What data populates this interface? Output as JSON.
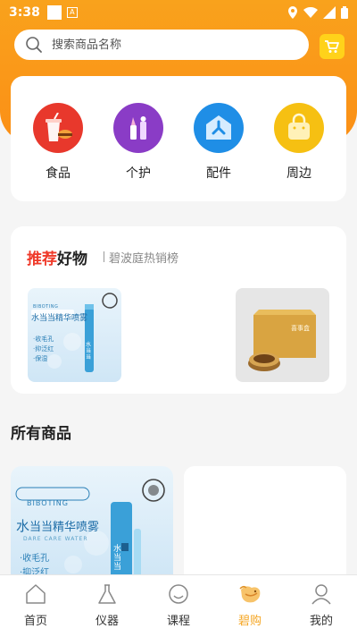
{
  "status_bar": {
    "time": "3:38",
    "right_icons": [
      "location-icon",
      "wifi-icon",
      "signal-icon",
      "battery-icon"
    ]
  },
  "search": {
    "placeholder": "搜索商品名称"
  },
  "categories": [
    {
      "label": "食品",
      "icon": "food-icon",
      "color": "#e8382c"
    },
    {
      "label": "个护",
      "icon": "cosmetics-icon",
      "color": "#8a3cc6"
    },
    {
      "label": "配件",
      "icon": "accessory-icon",
      "color": "#1f8ee6"
    },
    {
      "label": "周边",
      "icon": "bag-icon",
      "color": "#f6c012"
    }
  ],
  "recommend": {
    "title_red": "推荐",
    "title_rest": "好物",
    "subtitle": "碧波庭热销榜",
    "products": [
      {
        "icon": "spray-product-image",
        "brand": "BIBOTING",
        "name": "水当当精华喷雾",
        "tag": "水当当",
        "features": [
          "·收毛孔",
          "·抑泛红",
          "·保湿"
        ]
      },
      {
        "icon": "gift-box-product-image",
        "box_label": "喜事盒"
      }
    ]
  },
  "all_products": {
    "title": "所有商品",
    "items": [
      {
        "icon": "spray-product-image",
        "brand": "BIBOTING",
        "name": "当当精华喷雾",
        "name_prefix": "水",
        "tagline": "DARE CARE WATER",
        "bottle_text": "水当当",
        "features": [
          "·收毛孔",
          "·抑泛红"
        ]
      },
      {
        "icon": "blank-product-image"
      }
    ]
  },
  "tabs": [
    {
      "label": "首页",
      "icon": "home-icon",
      "active": false
    },
    {
      "label": "仪器",
      "icon": "flask-icon",
      "active": false
    },
    {
      "label": "课程",
      "icon": "smile-icon",
      "active": false
    },
    {
      "label": "碧购",
      "icon": "bird-icon",
      "active": true
    },
    {
      "label": "我的",
      "icon": "person-icon",
      "active": false
    }
  ],
  "colors": {
    "accent": "#f99c1b",
    "highlight_red": "#ef3a2a",
    "active_tab": "#f5a623"
  }
}
